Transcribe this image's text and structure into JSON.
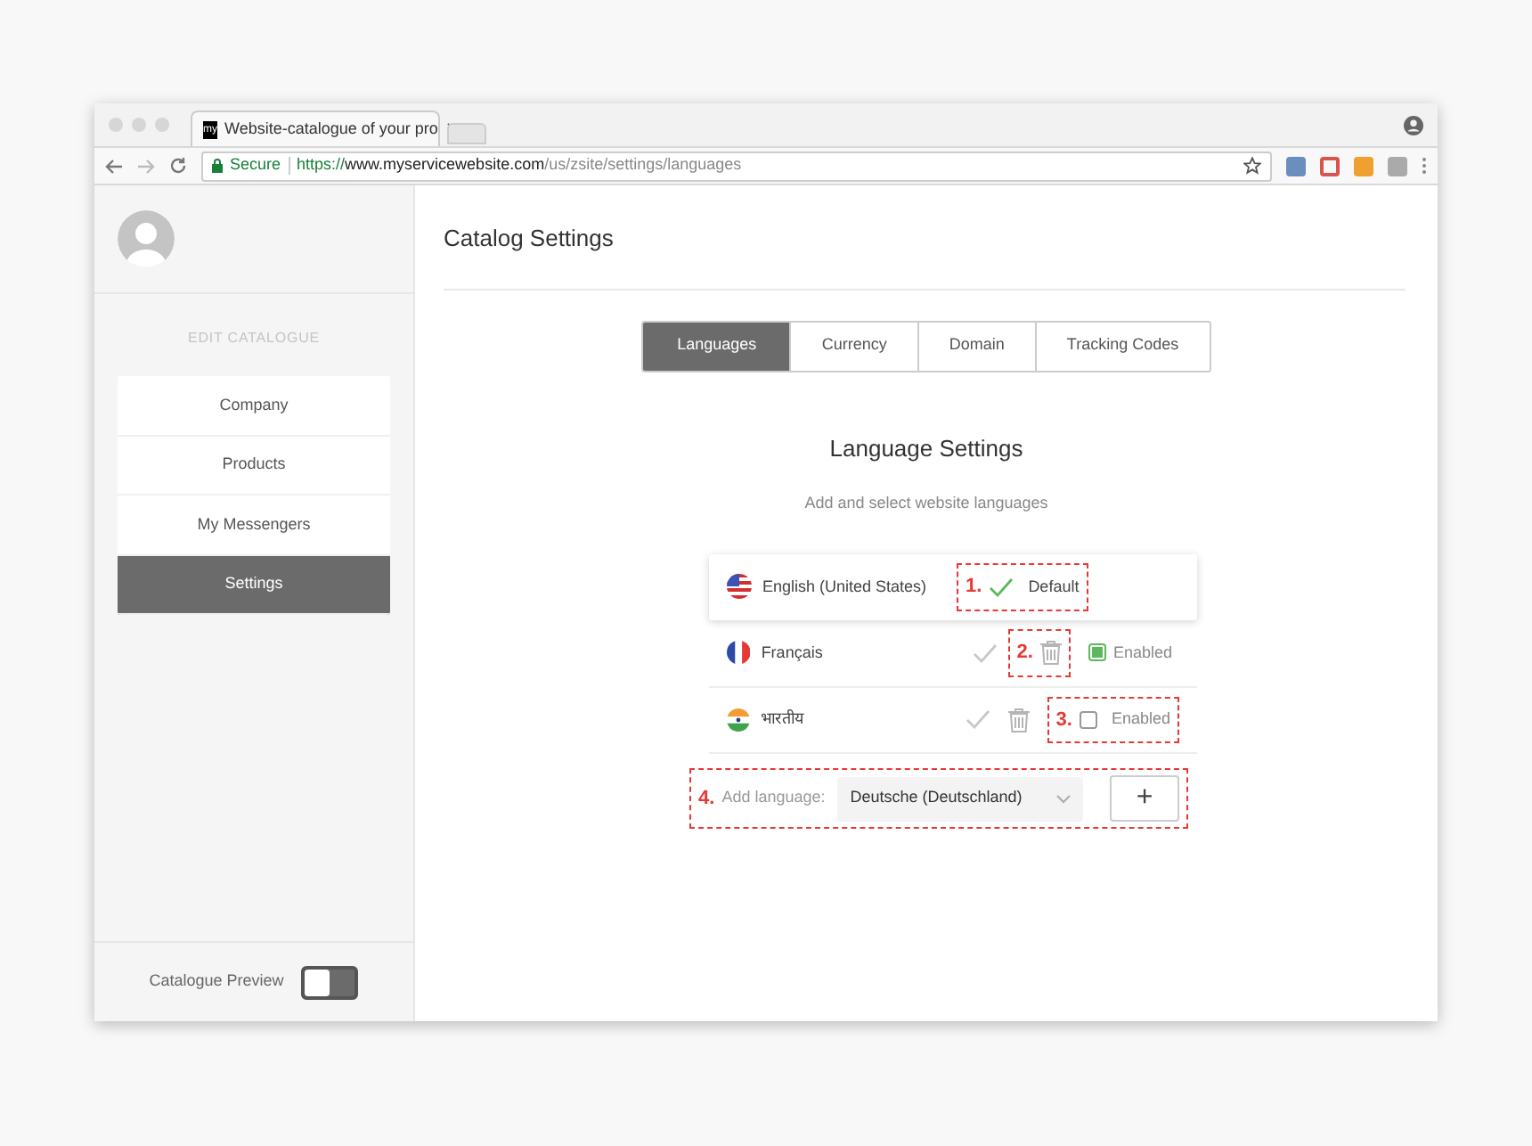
{
  "browser": {
    "tab_title": "Website-catalogue of your pro",
    "secure_label": "Secure",
    "url_scheme": "https://",
    "url_host": "www.myservicewebsite.com",
    "url_path": "/us/zsite/settings/languages",
    "favicon_text": "my"
  },
  "sidebar": {
    "section_title": "EDIT CATALOGUE",
    "items": [
      {
        "label": "Company",
        "selected": false
      },
      {
        "label": "Products",
        "selected": false
      },
      {
        "label": "My Messengers",
        "selected": false
      },
      {
        "label": "Settings",
        "selected": true
      }
    ],
    "preview": {
      "label": "Catalogue Preview",
      "on": false
    }
  },
  "page_title": "Catalog Settings",
  "tabs": [
    {
      "label": "Languages",
      "selected": true
    },
    {
      "label": "Currency",
      "selected": false
    },
    {
      "label": "Domain",
      "selected": false
    },
    {
      "label": "Tracking Codes",
      "selected": false
    }
  ],
  "section": {
    "title": "Language Settings",
    "subtitle": "Add and select website languages"
  },
  "languages": [
    {
      "kind": "us",
      "name": "English (United States)",
      "is_default": true,
      "default_label": "Default",
      "default_callout": "1."
    },
    {
      "kind": "fr",
      "name": "Français",
      "is_default": false,
      "enabled": true,
      "enabled_label": "Enabled",
      "delete_callout": "2."
    },
    {
      "kind": "in",
      "name": "भारतीय",
      "is_default": false,
      "enabled": false,
      "enabled_label": "Enabled",
      "enabled_callout": "3."
    }
  ],
  "add_language": {
    "callout": "4.",
    "label": "Add language:",
    "value": "Deutsche (Deutschland)",
    "button": "+"
  }
}
